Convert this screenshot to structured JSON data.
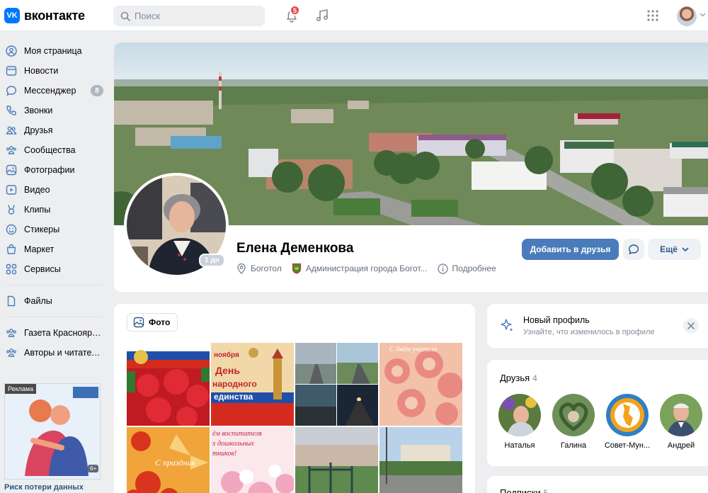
{
  "header": {
    "logo_letters": "VK",
    "logo_text": "вконтакте",
    "search_placeholder": "Поиск",
    "notifications_count": "5"
  },
  "sidebar": {
    "items": [
      {
        "label": "Моя страница",
        "icon": "user-circle-icon"
      },
      {
        "label": "Новости",
        "icon": "news-icon"
      },
      {
        "label": "Мессенджер",
        "icon": "message-icon",
        "count": "8"
      },
      {
        "label": "Звонки",
        "icon": "phone-icon"
      },
      {
        "label": "Друзья",
        "icon": "friends-icon"
      },
      {
        "label": "Сообщества",
        "icon": "communities-icon"
      },
      {
        "label": "Фотографии",
        "icon": "photo-icon"
      },
      {
        "label": "Видео",
        "icon": "video-icon"
      },
      {
        "label": "Клипы",
        "icon": "clips-icon"
      },
      {
        "label": "Стикеры",
        "icon": "sticker-icon"
      },
      {
        "label": "Маркет",
        "icon": "market-icon"
      },
      {
        "label": "Сервисы",
        "icon": "services-icon"
      }
    ],
    "files_label": "Файлы",
    "groups": [
      {
        "label": "Газета Красноярс..."
      },
      {
        "label": "Авторы и читател..."
      }
    ],
    "ad_tag": "Реклама",
    "ad_badge": "6+",
    "ad_title": "Риск потери данных"
  },
  "profile": {
    "name": "Елена Деменкова",
    "online": "1 дн",
    "city": "Боготол",
    "workplace": "Администрация города Богот...",
    "more_info": "Подробнее",
    "add_friend_label": "Добавить в друзья",
    "more_label": "Ещё"
  },
  "photos": {
    "tab_label": "Фото",
    "captions": [
      "",
      "ноября\nДень\nнародного\nединства",
      "",
      "С днём учителя",
      "С праздник",
      "ём воспитателя\nх дошкольных\nтников!",
      "",
      ""
    ]
  },
  "new_profile": {
    "title": "Новый профиль",
    "subtitle": "Узнайте, что изменилось в профиле"
  },
  "friends": {
    "title": "Друзья",
    "count": "4",
    "list": [
      {
        "name": "Наталья"
      },
      {
        "name": "Галина"
      },
      {
        "name": "Совет-Мун..."
      },
      {
        "name": "Андрей"
      }
    ]
  },
  "subscriptions": {
    "title": "Подписки",
    "count": "5"
  }
}
